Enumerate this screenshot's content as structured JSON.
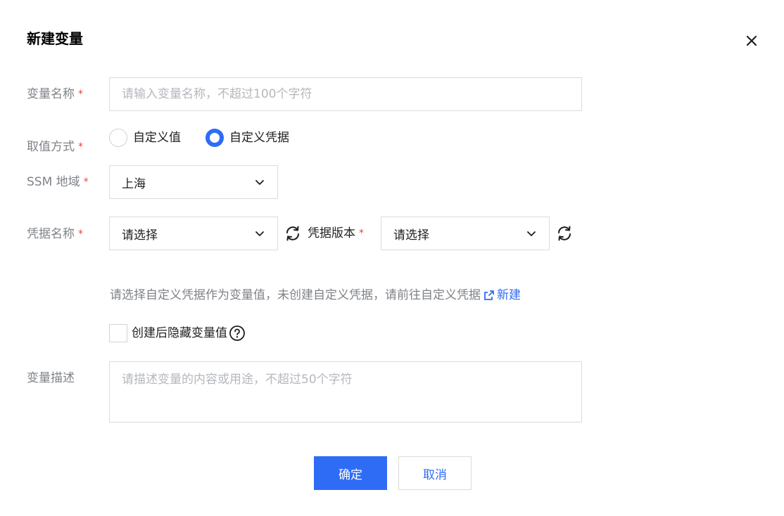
{
  "dialog": {
    "title": "新建变量",
    "close_icon": "close-icon"
  },
  "form": {
    "name": {
      "label": "变量名称",
      "required": "*",
      "placeholder": "请输入变量名称，不超过100个字符",
      "value": ""
    },
    "value_mode": {
      "label": "取值方式",
      "required": "*",
      "options": [
        {
          "label": "自定义值",
          "checked": false
        },
        {
          "label": "自定义凭据",
          "checked": true
        }
      ]
    },
    "region": {
      "label": "SSM 地域",
      "required": "*",
      "selected": "上海"
    },
    "credential": {
      "label": "凭据名称",
      "required": "*",
      "selected": "请选择",
      "version_label": "凭据版本",
      "version_required": "*",
      "version_selected": "请选择"
    },
    "hint": {
      "text": "请选择自定义凭据作为变量值，未创建自定义凭据，请前往自定义凭据",
      "link_label": "新建"
    },
    "hide_value": {
      "label": "创建后隐藏变量值",
      "checked": false
    },
    "description": {
      "label": "变量描述",
      "placeholder": "请描述变量的内容或用途，不超过50个字符",
      "value": ""
    }
  },
  "footer": {
    "confirm_label": "确定",
    "cancel_label": "取消"
  },
  "colors": {
    "primary": "#2f6cf6",
    "required": "#e54545",
    "label": "#7f8288",
    "border": "#dcdcdc"
  }
}
